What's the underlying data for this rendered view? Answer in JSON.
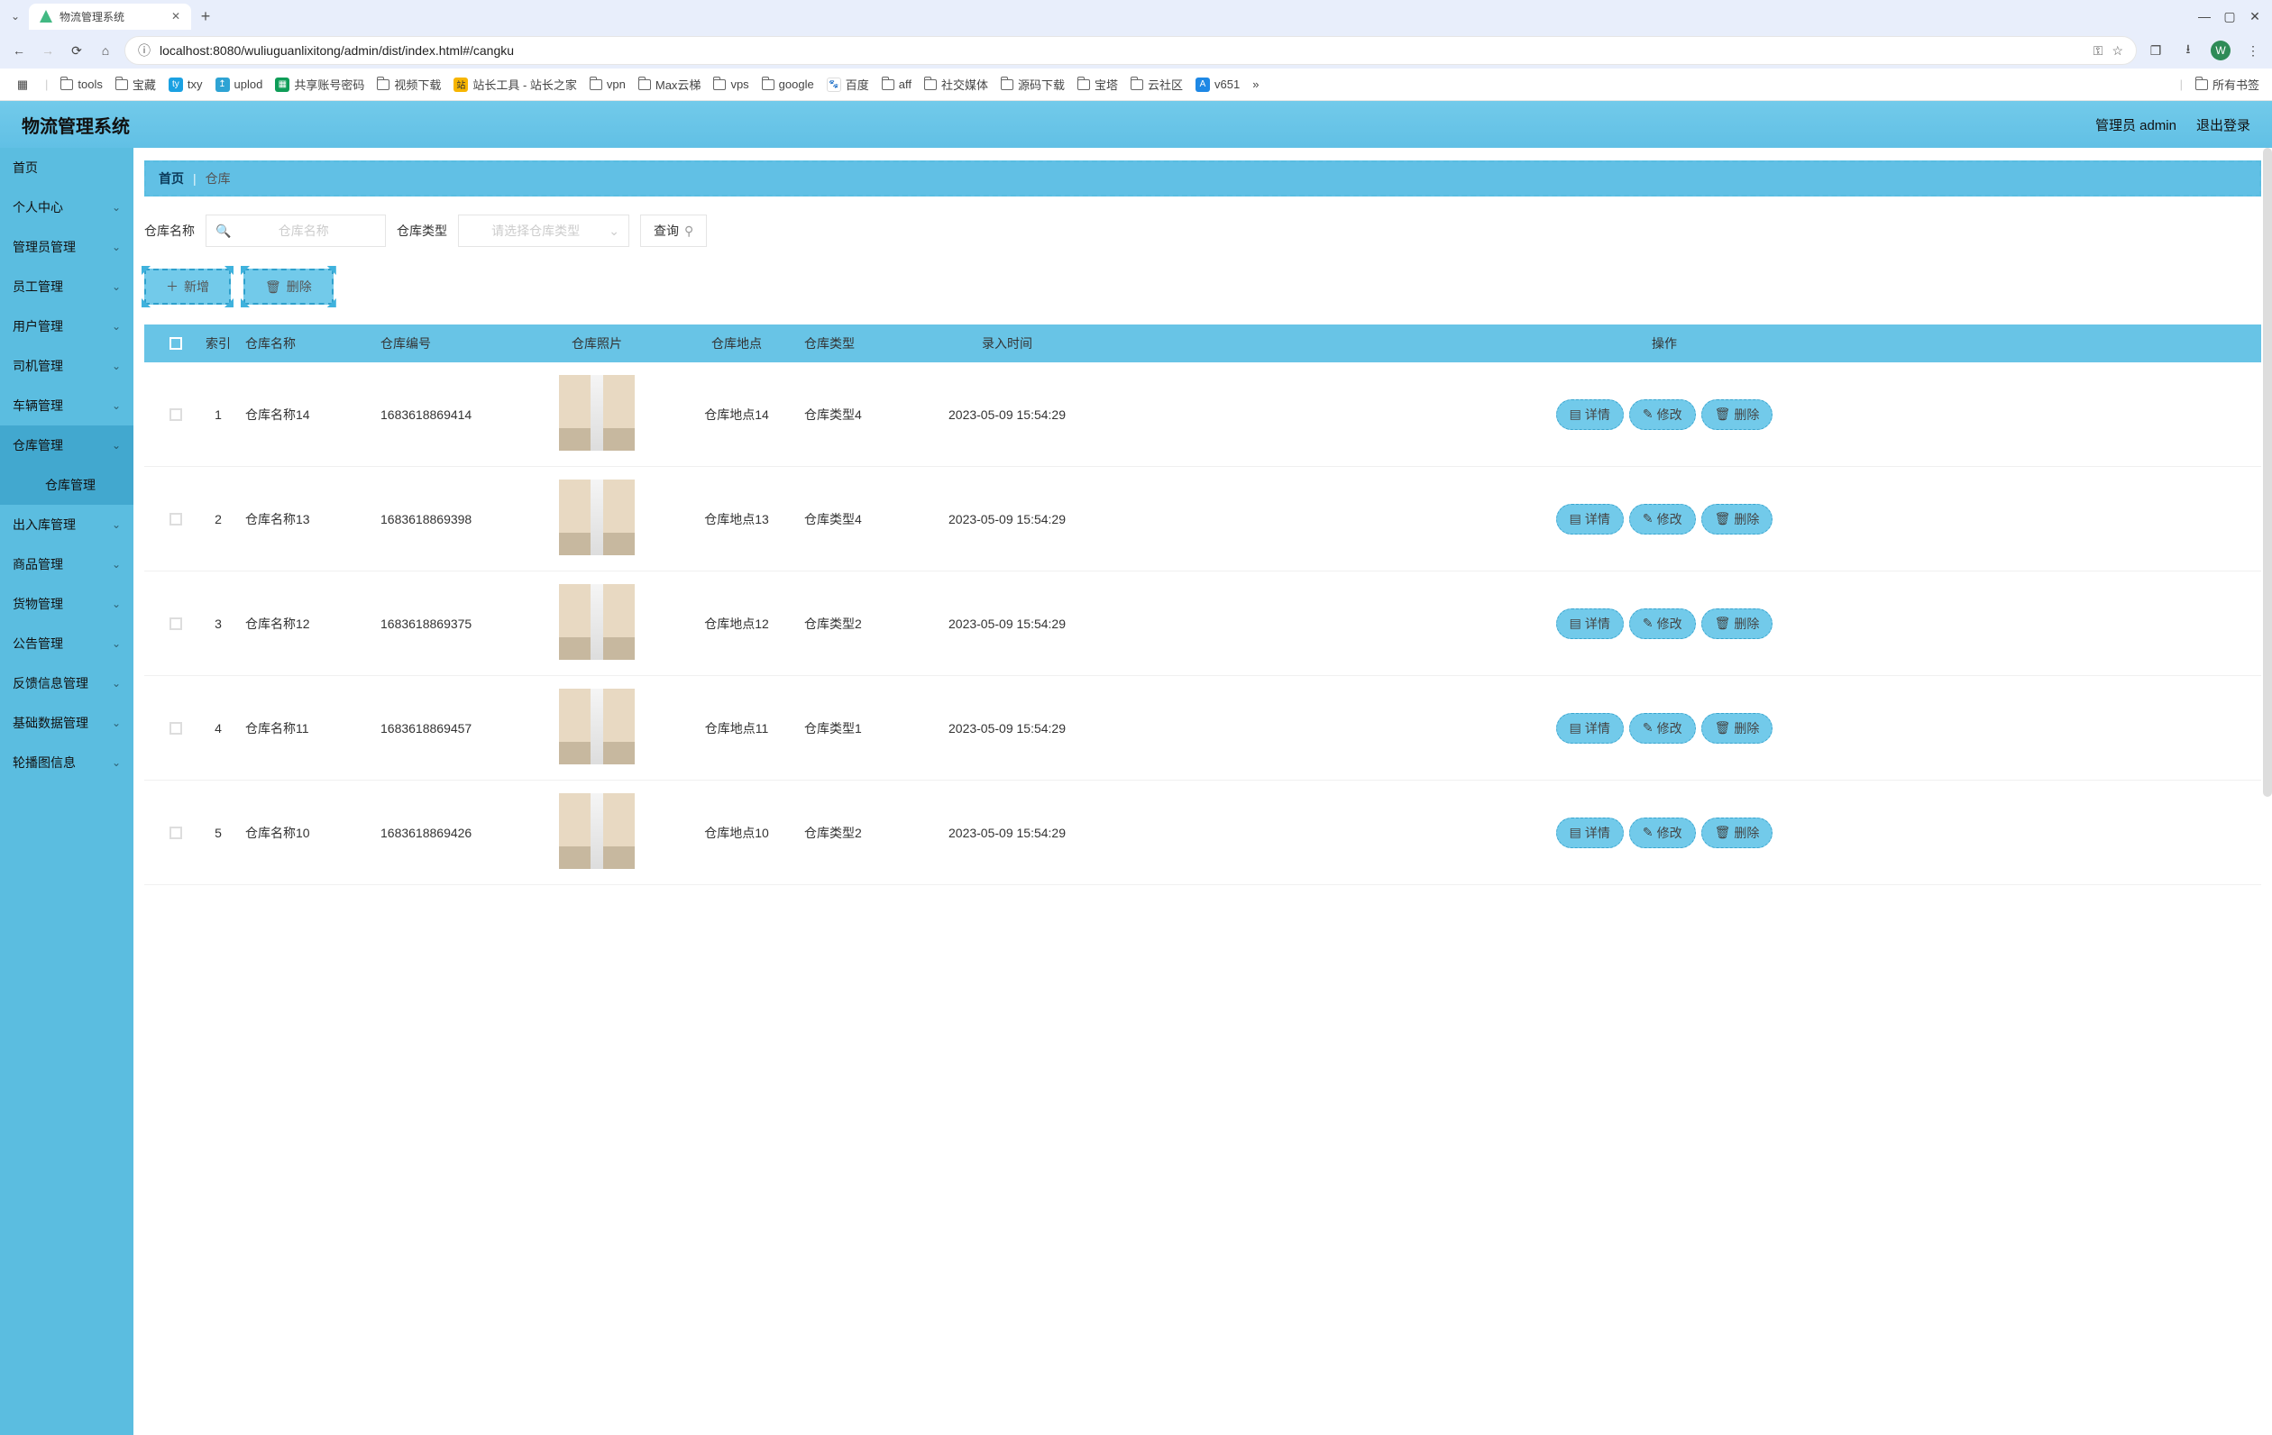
{
  "browser": {
    "tab_title": "物流管理系统",
    "url_host": "localhost:8080",
    "url_path": "/wuliuguanlixitong/admin/dist/index.html#/cangku",
    "avatar_letter": "W",
    "window_controls": {
      "minimize": "—",
      "maximize": "▢",
      "close": "✕"
    }
  },
  "bookmarks": [
    "tools",
    "宝藏",
    "txy",
    "uplod",
    "共享账号密码",
    "视频下载",
    "站长工具 - 站长之家",
    "vpn",
    "Max云梯",
    "vps",
    "google",
    "百度",
    "aff",
    "社交媒体",
    "源码下载",
    "宝塔",
    "云社区",
    "v651"
  ],
  "bookmarks_right": "所有书签",
  "header": {
    "title": "物流管理系统",
    "user_label": "管理员 admin",
    "logout": "退出登录"
  },
  "sidebar": {
    "items": [
      {
        "label": "首页",
        "has_sub": false,
        "active": false
      },
      {
        "label": "个人中心",
        "has_sub": true,
        "active": false
      },
      {
        "label": "管理员管理",
        "has_sub": true,
        "active": false
      },
      {
        "label": "员工管理",
        "has_sub": true,
        "active": false
      },
      {
        "label": "用户管理",
        "has_sub": true,
        "active": false
      },
      {
        "label": "司机管理",
        "has_sub": true,
        "active": false
      },
      {
        "label": "车辆管理",
        "has_sub": true,
        "active": false
      },
      {
        "label": "仓库管理",
        "has_sub": true,
        "active": true
      },
      {
        "label": "仓库管理",
        "is_sub": true
      },
      {
        "label": "出入库管理",
        "has_sub": true,
        "active": false
      },
      {
        "label": "商品管理",
        "has_sub": true,
        "active": false
      },
      {
        "label": "货物管理",
        "has_sub": true,
        "active": false
      },
      {
        "label": "公告管理",
        "has_sub": true,
        "active": false
      },
      {
        "label": "反馈信息管理",
        "has_sub": true,
        "active": false
      },
      {
        "label": "基础数据管理",
        "has_sub": true,
        "active": false
      },
      {
        "label": "轮播图信息",
        "has_sub": true,
        "active": false
      }
    ]
  },
  "breadcrumb": {
    "home": "首页",
    "sep": "|",
    "current": "仓库"
  },
  "search": {
    "name_label": "仓库名称",
    "name_placeholder": "仓库名称",
    "type_label": "仓库类型",
    "type_placeholder": "请选择仓库类型",
    "query_btn": "查询"
  },
  "actions": {
    "add": "新增",
    "delete": "删除"
  },
  "table": {
    "headers": {
      "idx": "索引",
      "name": "仓库名称",
      "code": "仓库编号",
      "photo": "仓库照片",
      "loc": "仓库地点",
      "type": "仓库类型",
      "time": "录入时间",
      "op": "操作"
    },
    "rows": [
      {
        "idx": "1",
        "name": "仓库名称14",
        "code": "1683618869414",
        "loc": "仓库地点14",
        "type": "仓库类型4",
        "time": "2023-05-09 15:54:29"
      },
      {
        "idx": "2",
        "name": "仓库名称13",
        "code": "1683618869398",
        "loc": "仓库地点13",
        "type": "仓库类型4",
        "time": "2023-05-09 15:54:29"
      },
      {
        "idx": "3",
        "name": "仓库名称12",
        "code": "1683618869375",
        "loc": "仓库地点12",
        "type": "仓库类型2",
        "time": "2023-05-09 15:54:29"
      },
      {
        "idx": "4",
        "name": "仓库名称11",
        "code": "1683618869457",
        "loc": "仓库地点11",
        "type": "仓库类型1",
        "time": "2023-05-09 15:54:29"
      },
      {
        "idx": "5",
        "name": "仓库名称10",
        "code": "1683618869426",
        "loc": "仓库地点10",
        "type": "仓库类型2",
        "time": "2023-05-09 15:54:29"
      }
    ],
    "op_labels": {
      "detail": "详情",
      "edit": "修改",
      "delete": "删除"
    }
  }
}
